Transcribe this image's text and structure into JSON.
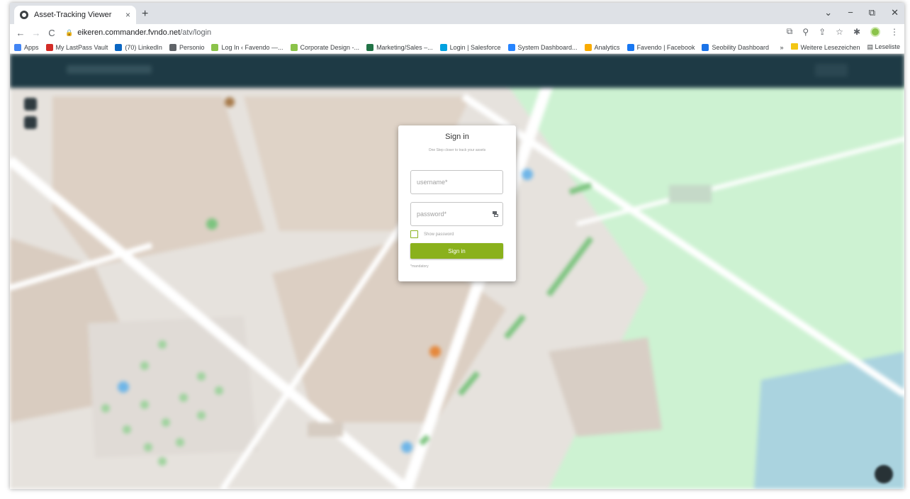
{
  "browser": {
    "tab_title": "Asset-Tracking Viewer",
    "tab_close": "×",
    "new_tab": "+",
    "url_host": "eikeren.commander.fvndo.net",
    "url_path": "/atv/login",
    "window_controls": [
      "⌄",
      "−",
      "⧉",
      "✕"
    ],
    "bookmarks": [
      {
        "label": "Apps",
        "color": "#4285f4"
      },
      {
        "label": "My LastPass Vault",
        "color": "#d32d27"
      },
      {
        "label": "(70) LinkedIn",
        "color": "#0a66c2"
      },
      {
        "label": "Personio",
        "color": "#5f6368"
      },
      {
        "label": "Log In ‹ Favendo —...",
        "color": "#8bc34a"
      },
      {
        "label": "Corporate Design -...",
        "color": "#8bc34a"
      },
      {
        "label": "Marketing/Sales –...",
        "color": "#217346"
      },
      {
        "label": "Login | Salesforce",
        "color": "#00a1e0"
      },
      {
        "label": "System Dashboard...",
        "color": "#2684ff"
      },
      {
        "label": "Analytics",
        "color": "#f9ab00"
      },
      {
        "label": "Favendo | Facebook",
        "color": "#1877f2"
      },
      {
        "label": "Seobility Dashboard",
        "color": "#1a73e8"
      }
    ],
    "bookmarks_more": "»",
    "other_bookmarks": "Weitere Lesezeichen",
    "reading_list": "Leseliste"
  },
  "login": {
    "title": "Sign in",
    "subtitle": "One Step closer to track your assets",
    "username_placeholder": "username*",
    "password_placeholder": "password*",
    "show_password_label": "Show password",
    "submit_label": "Sign in",
    "mandatory_note": "*mandatory",
    "show_password_checked": false
  },
  "colors": {
    "accent": "#8ab11c",
    "appbar": "#1e3a45",
    "map_background": "#e8e4df",
    "map_park": "#c8f0cf",
    "map_water": "#aad3df"
  }
}
